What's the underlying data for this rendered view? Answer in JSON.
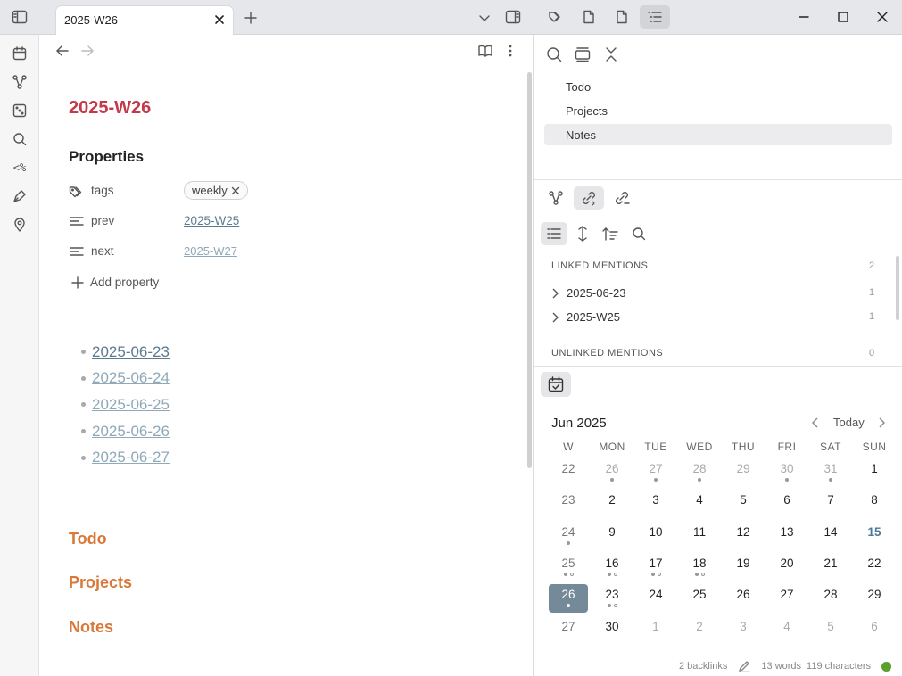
{
  "tab": {
    "title": "2025-W26"
  },
  "note": {
    "title": "2025-W26",
    "properties_heading": "Properties",
    "properties": [
      {
        "key": "tags",
        "icon": "tags-icon",
        "value_type": "pill",
        "value": "weekly"
      },
      {
        "key": "prev",
        "icon": "text-lines-icon",
        "value_type": "link",
        "value": "2025-W25"
      },
      {
        "key": "next",
        "icon": "text-lines-icon",
        "value_type": "link",
        "value": "2025-W27"
      }
    ],
    "add_property": "Add property",
    "dates": [
      "2025-06-23",
      "2025-06-24",
      "2025-06-25",
      "2025-06-26",
      "2025-06-27"
    ],
    "sections": [
      "Todo",
      "Projects",
      "Notes"
    ]
  },
  "outline": {
    "items": [
      "Todo",
      "Projects",
      "Notes"
    ],
    "selected": "Notes"
  },
  "backlinks": {
    "linked_label": "LINKED MENTIONS",
    "linked_count": "2",
    "linked": [
      {
        "title": "2025-06-23",
        "count": "1"
      },
      {
        "title": "2025-W25",
        "count": "1"
      }
    ],
    "unlinked_label": "UNLINKED MENTIONS",
    "unlinked_count": "0"
  },
  "calendar": {
    "month": "Jun 2025",
    "today_label": "Today",
    "headers": [
      "W",
      "MON",
      "TUE",
      "WED",
      "THU",
      "FRI",
      "SAT",
      "SUN"
    ],
    "weeks": [
      {
        "w": "22",
        "days": [
          [
            "26",
            "adj",
            "f"
          ],
          [
            "27",
            "adj",
            "f"
          ],
          [
            "28",
            "adj",
            "f"
          ],
          [
            "29",
            "adj",
            ""
          ],
          [
            "30",
            "adj",
            "f"
          ],
          [
            "31",
            "adj",
            "f"
          ],
          [
            "1",
            "cur",
            ""
          ]
        ]
      },
      {
        "w": "23",
        "days": [
          [
            "2",
            "cur",
            ""
          ],
          [
            "3",
            "cur",
            ""
          ],
          [
            "4",
            "cur",
            ""
          ],
          [
            "5",
            "cur",
            ""
          ],
          [
            "6",
            "cur",
            ""
          ],
          [
            "7",
            "cur",
            ""
          ],
          [
            "8",
            "cur",
            ""
          ]
        ]
      },
      {
        "w": "24",
        "wdots": "f",
        "days": [
          [
            "9",
            "cur",
            ""
          ],
          [
            "10",
            "cur",
            ""
          ],
          [
            "11",
            "cur",
            ""
          ],
          [
            "12",
            "cur",
            ""
          ],
          [
            "13",
            "cur",
            ""
          ],
          [
            "14",
            "cur",
            ""
          ],
          [
            "15",
            "today",
            ""
          ]
        ]
      },
      {
        "w": "25",
        "wdots": "fo",
        "days": [
          [
            "16",
            "cur",
            "fo"
          ],
          [
            "17",
            "cur",
            "fo"
          ],
          [
            "18",
            "cur",
            "fo"
          ],
          [
            "19",
            "cur",
            ""
          ],
          [
            "20",
            "cur",
            ""
          ],
          [
            "21",
            "cur",
            ""
          ],
          [
            "22",
            "cur",
            ""
          ]
        ]
      },
      {
        "w": "26",
        "wdots": "f",
        "wsel": true,
        "days": [
          [
            "23",
            "cur",
            "fo"
          ],
          [
            "24",
            "cur",
            ""
          ],
          [
            "25",
            "cur",
            ""
          ],
          [
            "26",
            "cur",
            ""
          ],
          [
            "27",
            "cur",
            ""
          ],
          [
            "28",
            "cur",
            ""
          ],
          [
            "29",
            "cur",
            ""
          ]
        ]
      },
      {
        "w": "27",
        "days": [
          [
            "30",
            "cur",
            ""
          ],
          [
            "1",
            "adj",
            ""
          ],
          [
            "2",
            "adj",
            ""
          ],
          [
            "3",
            "adj",
            ""
          ],
          [
            "4",
            "adj",
            ""
          ],
          [
            "5",
            "adj",
            ""
          ],
          [
            "6",
            "adj",
            ""
          ]
        ]
      }
    ]
  },
  "status": {
    "backlinks": "2 backlinks",
    "words": "13 words",
    "characters": "119 characters",
    "sync_color": "#5aa02c"
  },
  "colors": {
    "title": "#c4384a",
    "heading": "#d97838",
    "link": "#5b7b8f",
    "link_faded": "#8fa9b8"
  }
}
